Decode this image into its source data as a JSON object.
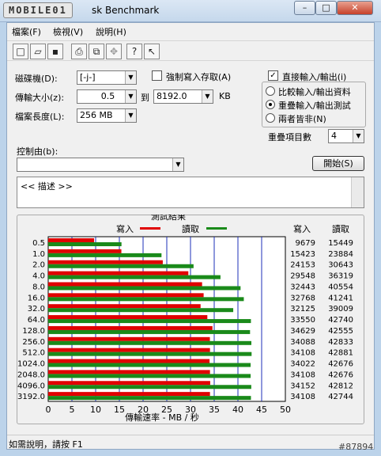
{
  "window": {
    "logo_text": "MOBILE01",
    "title": "sk Benchmark",
    "min_label": "–",
    "max_label": "□",
    "close_label": "✕"
  },
  "menu": [
    "檔案(F)",
    "檢視(V)",
    "說明(H)"
  ],
  "toolbar": [
    "new-icon",
    "open-icon",
    "save-icon",
    "print-icon",
    "print-preview-icon",
    "move-icon",
    "help-icon",
    "context-help-icon"
  ],
  "toolbar_glyphs": [
    "□",
    "▱",
    "▪",
    "⎙",
    "⧉",
    "✥",
    "?",
    "↖"
  ],
  "settings": {
    "drive_label": "磁碟機(D):",
    "drive_value": "[-j-]",
    "transfer_label": "傳輸大小(z):",
    "transfer_from": "0.5",
    "to_label": "到",
    "transfer_to": "8192.0",
    "unit": "KB",
    "length_label": "檔案長度(L):",
    "length_value": "256 MB",
    "force_write_label": "強制寫入存取(A)",
    "force_write_checked": false,
    "direct_io_label": "直接輸入/輸出(i)",
    "direct_io_checked": true,
    "radio_options": [
      "比較輸入/輸出資料",
      "重疊輸入/輸出測試",
      "兩者皆非(N)"
    ],
    "radio_selected": 1,
    "queue_label": "重疊項目數",
    "queue_value": "4",
    "control_label": "控制由(b):",
    "control_value": "",
    "start_label": "開始(S)",
    "desc_text": "<<    描述    >>"
  },
  "results": {
    "title": "測試結果",
    "legend_write": "寫入",
    "legend_read": "讀取",
    "col_write": "寫入",
    "col_read": "讀取",
    "write_color": "#e00000",
    "read_color": "#1a8a1a"
  },
  "chart_data": {
    "type": "bar",
    "orientation": "horizontal",
    "title": "測試結果",
    "xlabel": "傳輸速率 - MB / 秒",
    "xlim": [
      0,
      50
    ],
    "xticks": [
      0,
      5,
      10,
      15,
      20,
      25,
      30,
      35,
      40,
      45,
      50
    ],
    "grid": true,
    "legend_placement": "top",
    "categories": [
      "0.5",
      "1.0",
      "2.0",
      "4.0",
      "8.0",
      "16.0",
      "32.0",
      "64.0",
      "128.0",
      "256.0",
      "512.0",
      "1024.0",
      "2048.0",
      "4096.0",
      "3192.0"
    ],
    "series": [
      {
        "name": "寫入",
        "values_kbps": [
          9679,
          15423,
          24153,
          29548,
          32443,
          32768,
          32125,
          33550,
          34629,
          34088,
          34108,
          34022,
          34108,
          34152,
          34108
        ]
      },
      {
        "name": "讀取",
        "values_kbps": [
          15449,
          23884,
          30643,
          36319,
          40554,
          41241,
          39009,
          42740,
          42555,
          42833,
          42881,
          42676,
          42676,
          42812,
          42744
        ]
      }
    ]
  },
  "status": {
    "text": "如需說明，請按 F1"
  },
  "watermark": "#87894"
}
